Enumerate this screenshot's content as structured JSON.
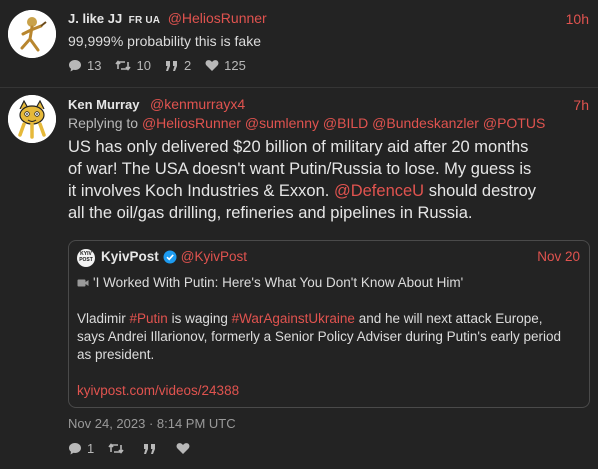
{
  "tweet1": {
    "name": "J. like JJ",
    "flags": "FR UA",
    "handle": "@HeliosRunner",
    "time": "10h",
    "text": "99,999% probability this is fake",
    "replies": "13",
    "retweets": "10",
    "quotes": "2",
    "likes": "125"
  },
  "tweet2": {
    "name": "Ken Murray",
    "handle": "@kenmurrayx4",
    "time": "7h",
    "replying_to_label": "Replying to",
    "replying_to": [
      "@HeliosRunner",
      "@sumlenny",
      "@BILD",
      "@Bundeskanzler",
      "@POTUS"
    ],
    "text_line1": "US has only delivered $20 billion of military aid after 20 months",
    "text_line2": "of war!  The USA doesn't want Putin/Russia to lose.  My guess is",
    "text_line3": "it involves Koch Industries & Exxon.",
    "text_mention": "@DefenceU",
    "text_line3_end": "should destroy",
    "text_line4": "all the oil/gas drilling, refineries and pipelines in Russia.",
    "date": "Nov 24, 2023 · 8:14 PM UTC",
    "replies": "1"
  },
  "quote": {
    "logo_text_1": "KYIV",
    "logo_text_2": "POST",
    "name": "KyivPost",
    "handle": "@KyivPost",
    "time": "Nov 20",
    "headline": "'I Worked With Putin: Here's What You Don't Know About Him'",
    "body_1a": "Vladimir",
    "tag_putin": "#Putin",
    "body_1b": "is waging",
    "tag_war": "#WarAgainstUkraine",
    "body_1c": "and he will next attack Europe,",
    "body_2": "says Andrei Illarionov, formerly a Senior Policy Adviser during Putin's early period",
    "body_3": "as president.",
    "link": "kyivpost.com/videos/24388"
  },
  "colors": {
    "accent": "#e0534f",
    "background": "#232323",
    "verified": "#1d9bf0"
  }
}
